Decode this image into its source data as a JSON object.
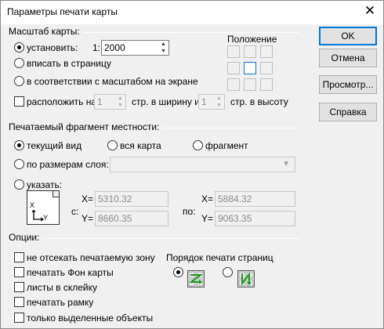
{
  "window": {
    "title": "Параметры печати карты"
  },
  "buttons": {
    "ok": "OK",
    "cancel": "Отмена",
    "preview": "Просмотр...",
    "help": "Справка"
  },
  "scale": {
    "group_label": "Масштаб карты:",
    "set_label": "установить:",
    "prefix": "1:",
    "value": "2000",
    "fit_page": "вписать в страницу",
    "screen_scale": "в соответствии с масштабом на экране",
    "arrange_label": "расположить на",
    "width_value": "1",
    "width_text": "стр. в ширину и",
    "height_value": "1",
    "height_text": "стр. в высоту"
  },
  "position": {
    "label": "Положение"
  },
  "fragment": {
    "group_label": "Печатаемый фрагмент местности:",
    "current_view": "текущий вид",
    "whole_map": "вся карта",
    "fragment": "фрагмент",
    "layer_size": "по размерам слоя:",
    "specify": "указать:",
    "from_label": "с:",
    "to_label": "по:",
    "x_label": "X=",
    "y_label": "Y=",
    "from_x": "5310.32",
    "from_y": "8660.35",
    "to_x": "5884.32",
    "to_y": "9063.35",
    "axis_x": "X",
    "axis_y": "Y"
  },
  "options": {
    "group_label": "Опции:",
    "no_clip": "не отсекать печатаемую зону",
    "print_background": "печатать Фон карты",
    "sheets_glue": "листы в склейку",
    "print_frame": "печатать рамку",
    "selected_only": "только выделенные объекты",
    "page_order_label": "Порядок печати страниц"
  }
}
